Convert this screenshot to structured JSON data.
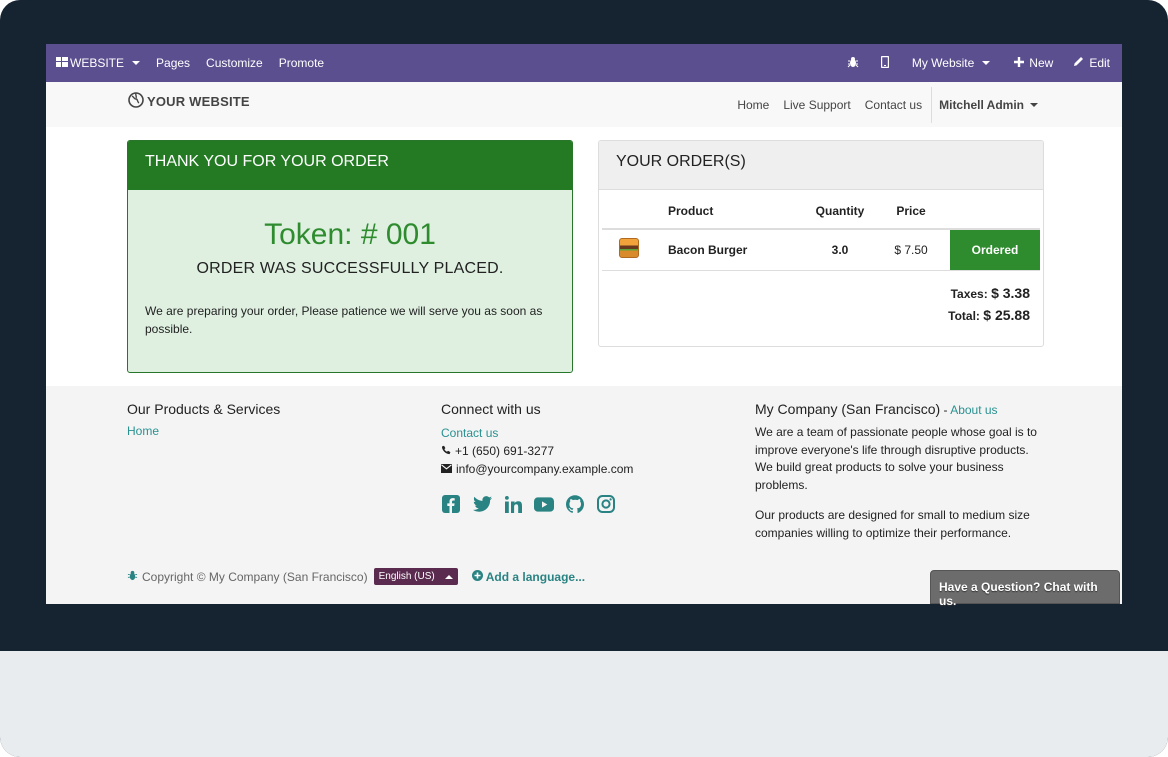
{
  "admin_bar": {
    "website_menu": "WEBSITE",
    "pages": "Pages",
    "customize": "Customize",
    "promote": "Promote",
    "site_selector": "My Website",
    "new": "New",
    "edit": "Edit"
  },
  "header": {
    "logo_text": "YOUR WEBSITE",
    "nav": [
      "Home",
      "Live Support",
      "Contact us"
    ],
    "user": "Mitchell Admin"
  },
  "thank_you": {
    "title": "THANK YOU FOR YOUR ORDER",
    "token": "Token: # 001",
    "status": "ORDER WAS SUCCESSFULLY PLACED.",
    "message": "We are preparing your order, Please patience we will serve you as soon as possible."
  },
  "orders": {
    "title": "YOUR ORDER(S)",
    "columns": [
      "Product",
      "Quantity",
      "Price"
    ],
    "rows": [
      {
        "product": "Bacon Burger",
        "quantity": "3.0",
        "price": "$ 7.50",
        "status": "Ordered"
      }
    ],
    "taxes_label": "Taxes:",
    "taxes_value": "$ 3.38",
    "total_label": "Total:",
    "total_value": "$ 25.88"
  },
  "footer": {
    "col1_title": "Our Products & Services",
    "col1_link": "Home",
    "col2_title": "Connect with us",
    "col2_link": "Contact us",
    "phone": "+1 (650) 691-3277",
    "email": "info@yourcompany.example.com",
    "col3_title": "My Company (San Francisco)",
    "col3_sep": " - ",
    "col3_link": "About us",
    "about_p1": "We are a team of passionate people whose goal is to improve everyone's life through disruptive products. We build great products to solve your business problems.",
    "about_p2": "Our products are designed for small to medium size companies willing to optimize their performance.",
    "copyright": "Copyright © My Company (San Francisco)",
    "language": "English (US)",
    "add_language": "Add a language..."
  },
  "chat_button": "Have a Question? Chat with us.",
  "colors": {
    "admin_bar": "#5b4f8f",
    "success_green": "#237a23",
    "link_teal": "#2a9191",
    "language_badge": "#5b2a4f"
  }
}
